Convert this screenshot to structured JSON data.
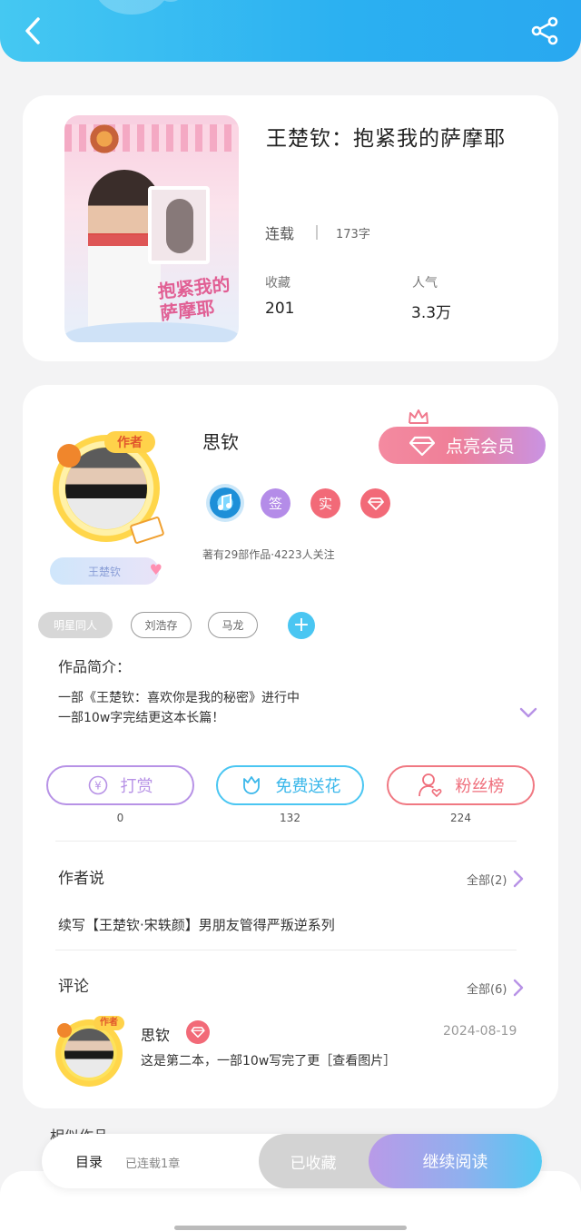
{
  "header": {
    "back_icon": "chevron-left-icon",
    "share_icon": "share-icon"
  },
  "book": {
    "title": "王楚钦：抱紧我的萨摩耶",
    "status": "连载",
    "word_count": "173字",
    "favorites_label": "收藏",
    "favorites_value": "201",
    "popularity_label": "人气",
    "popularity_value": "3.3万",
    "cover_text": "抱紧我的萨摩耶"
  },
  "author": {
    "name": "思钦",
    "tag": "作者",
    "badge_name": "王楚钦",
    "vip_button": "点亮会员",
    "badges": {
      "sign": "签",
      "real": "实"
    },
    "stats": "著有29部作品·4223人关注"
  },
  "tags": [
    "明星同人",
    "刘浩存",
    "马龙"
  ],
  "intro": {
    "title": "作品简介：",
    "lines": [
      "一部《王楚钦：喜欢你是我的秘密》进行中",
      "一部10w字完结更这本长篇！"
    ]
  },
  "actions": {
    "tip": {
      "label": "打赏",
      "count": "0"
    },
    "flower": {
      "label": "免费送花",
      "count": "132"
    },
    "fans": {
      "label": "粉丝榜",
      "count": "224"
    }
  },
  "author_say": {
    "title": "作者说",
    "all": "全部(2)",
    "text": "续写【王楚钦·宋轶颜】男朋友管得严叛逆系列"
  },
  "comments": {
    "title": "评论",
    "all": "全部(6)",
    "item": {
      "name": "思钦",
      "date": "2024-08-19",
      "text": "这是第二本，一部10w写完了更［查看图片］"
    }
  },
  "similar": {
    "title": "相似作品"
  },
  "bottom_bar": {
    "toc": "目录",
    "serial": "已连载1章",
    "collected": "已收藏",
    "continue": "继续阅读"
  },
  "colors": {
    "header": "#2bb0f1",
    "vip": "#ef7f98",
    "tip": "#b792e6",
    "flower": "#3ab7ea",
    "fans": "#ef6f7c"
  }
}
